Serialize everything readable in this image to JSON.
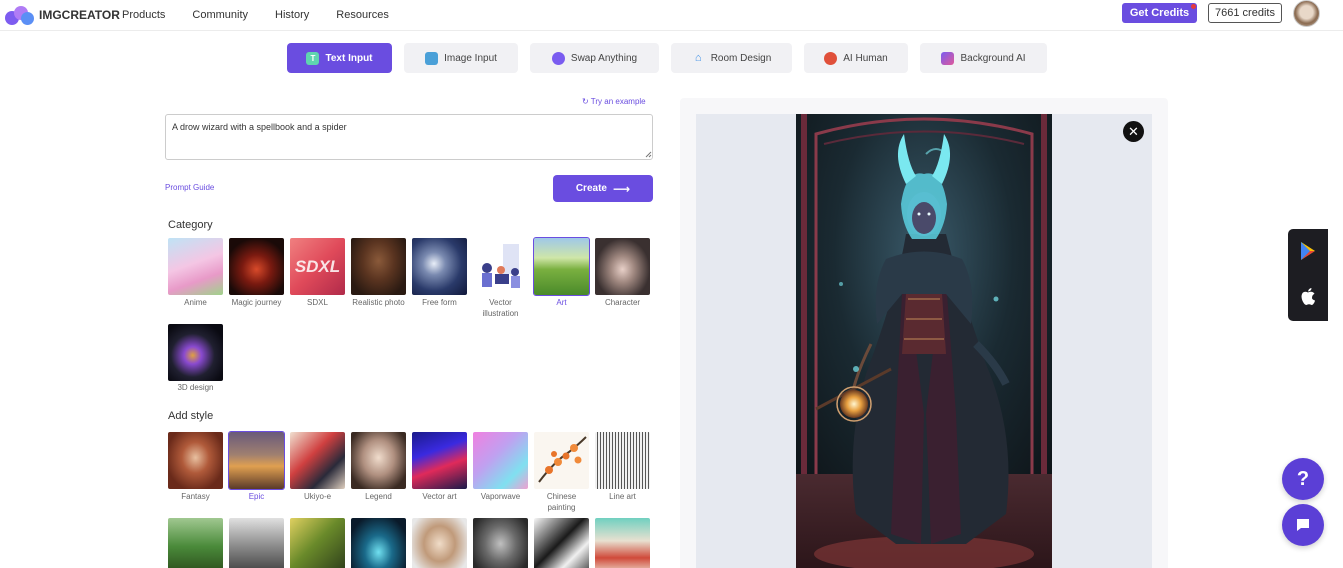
{
  "header": {
    "logo_text": "IMGCREATOR",
    "nav": [
      "Products",
      "Community",
      "History",
      "Resources"
    ],
    "get_credits": "Get Credits",
    "credits": "7661 credits",
    "colors": {
      "accent": "#6a4de0"
    }
  },
  "tabs": [
    {
      "label": "Text Input",
      "icon": "text-input-icon",
      "active": true
    },
    {
      "label": "Image Input",
      "icon": "image-input-icon",
      "active": false
    },
    {
      "label": "Swap Anything",
      "icon": "swap-icon",
      "active": false
    },
    {
      "label": "Room Design",
      "icon": "room-design-icon",
      "active": false
    },
    {
      "label": "AI Human",
      "icon": "ai-human-icon",
      "active": false
    },
    {
      "label": "Background AI",
      "icon": "background-ai-icon",
      "active": false
    }
  ],
  "prompt": {
    "try_example": "Try an example",
    "value": "A drow wizard with a spellbook and a spider",
    "prompt_guide": "Prompt Guide",
    "create_label": "Create"
  },
  "category": {
    "title": "Category",
    "items": [
      {
        "label": "Anime",
        "selected": false
      },
      {
        "label": "Magic journey",
        "selected": false
      },
      {
        "label": "SDXL",
        "selected": false
      },
      {
        "label": "Realistic photo",
        "selected": false
      },
      {
        "label": "Free form",
        "selected": false
      },
      {
        "label": "Vector illustration",
        "selected": false
      },
      {
        "label": "Art",
        "selected": true
      },
      {
        "label": "Character",
        "selected": false
      },
      {
        "label": "3D design",
        "selected": false
      }
    ]
  },
  "style": {
    "title": "Add style",
    "items": [
      {
        "label": "Fantasy",
        "selected": false
      },
      {
        "label": "Epic",
        "selected": true
      },
      {
        "label": "Ukiyo-e",
        "selected": false
      },
      {
        "label": "Legend",
        "selected": false
      },
      {
        "label": "Vector art",
        "selected": false
      },
      {
        "label": "Vaporwave",
        "selected": false
      },
      {
        "label": "Chinese painting",
        "selected": false
      },
      {
        "label": "Line art",
        "selected": false
      }
    ]
  },
  "fab": {
    "help": "?"
  }
}
